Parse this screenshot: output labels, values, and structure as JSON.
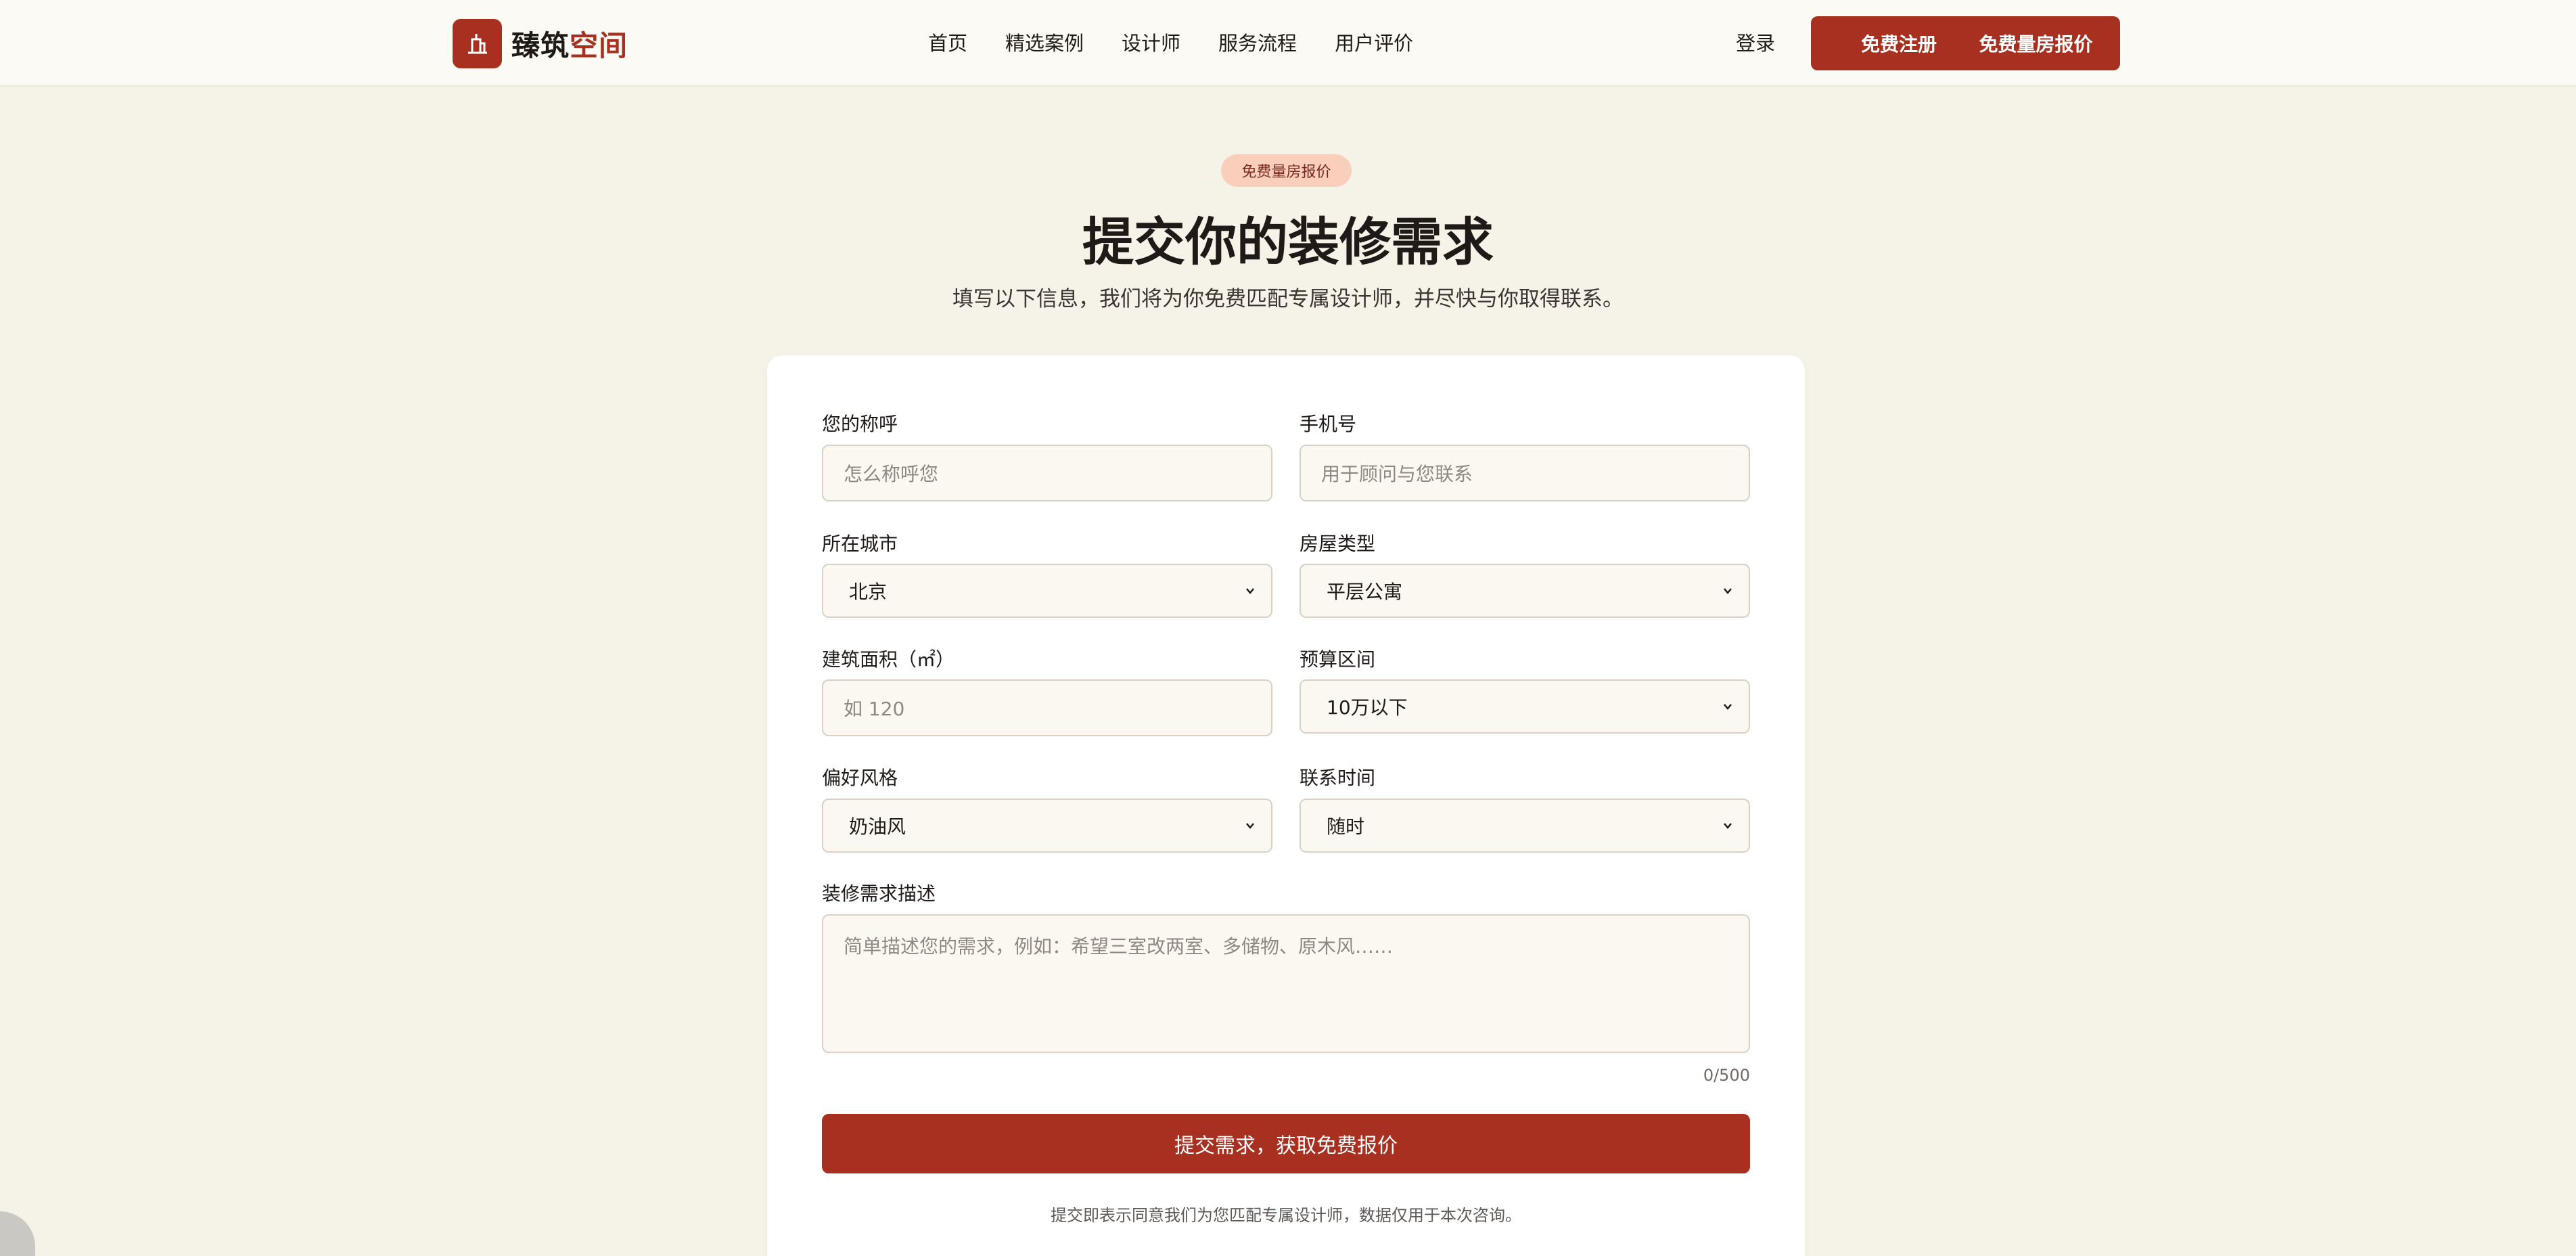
{
  "brand": {
    "name_part1": "臻筑",
    "name_part2": "空间",
    "logo_icon": "building-icon"
  },
  "nav": {
    "items": [
      "首页",
      "精选案例",
      "设计师",
      "服务流程",
      "用户评价"
    ]
  },
  "header_actions": {
    "login": "登录",
    "register": "免费注册",
    "quote": "免费量房报价"
  },
  "hero": {
    "pill": "免费量房报价",
    "title": "提交你的装修需求",
    "subtitle": "填写以下信息，我们将为你免费匹配专属设计师，并尽快与你取得联系。"
  },
  "form": {
    "name": {
      "label": "您的称呼",
      "placeholder": "怎么称呼您"
    },
    "phone": {
      "label": "手机号",
      "placeholder": "用于顾问与您联系"
    },
    "city": {
      "label": "所在城市",
      "value": "北京"
    },
    "house_type": {
      "label": "房屋类型",
      "value": "平层公寓"
    },
    "area": {
      "label": "建筑面积（㎡）",
      "placeholder": "如 120"
    },
    "budget": {
      "label": "预算区间",
      "value": "10万以下"
    },
    "style": {
      "label": "偏好风格",
      "value": "奶油风"
    },
    "contact_time": {
      "label": "联系时间",
      "value": "随时"
    },
    "description": {
      "label": "装修需求描述",
      "placeholder": "简单描述您的需求，例如：希望三室改两室、多储物、原木风……"
    },
    "counter": "0/500",
    "submit": "提交需求，获取免费报价",
    "disclaimer": "提交即表示同意我们为您匹配专属设计师，数据仅用于本次咨询。"
  },
  "colors": {
    "accent": "#a83020",
    "background": "#f5f2e8",
    "pill_bg": "#f9cfbb"
  }
}
